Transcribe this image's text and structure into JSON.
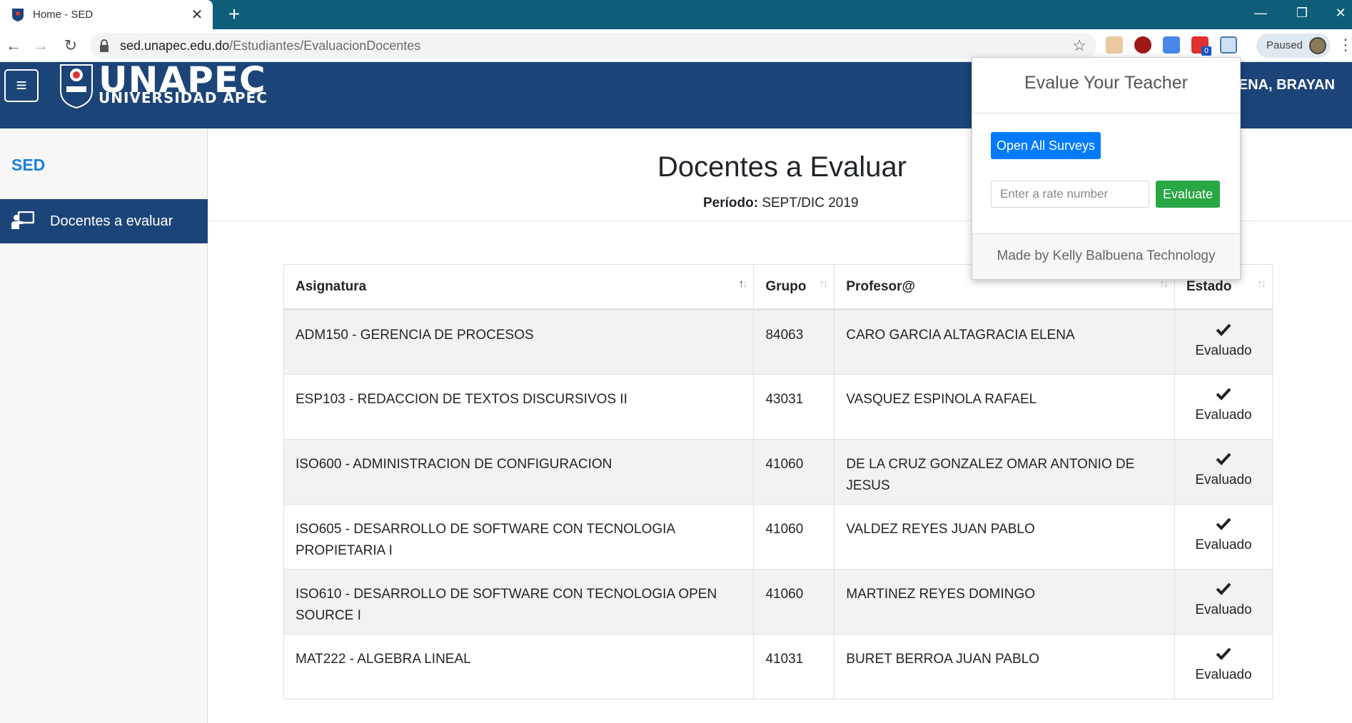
{
  "browser": {
    "tab_title": "Home - SED",
    "url_host": "sed.unapec.edu.do",
    "url_path": "/Estudiantes/EvaluacionDocentes",
    "profile_status": "Paused",
    "extension_badge": "0"
  },
  "header": {
    "logo_main": "UNAPEC",
    "logo_sub": "UNIVERSIDAD APEC",
    "user_name": "ENA, BRAYAN"
  },
  "sidebar": {
    "brand": "SED",
    "items": [
      {
        "label": "Docentes a evaluar",
        "icon": "teacher-board-icon"
      }
    ]
  },
  "main": {
    "title": "Docentes a Evaluar",
    "period_label": "Período:",
    "period_value": " SEPT/DIC 2019",
    "columns": [
      "Asignatura",
      "Grupo",
      "Profesor@",
      "Estado"
    ],
    "rows": [
      {
        "asignatura": "ADM150 - GERENCIA DE PROCESOS",
        "grupo": "84063",
        "profesor": "CARO GARCIA ALTAGRACIA ELENA",
        "estado": "Evaluado"
      },
      {
        "asignatura": "ESP103 - REDACCION DE TEXTOS DISCURSIVOS II",
        "grupo": "43031",
        "profesor": "VASQUEZ ESPINOLA RAFAEL",
        "estado": "Evaluado"
      },
      {
        "asignatura": "ISO600 - ADMINISTRACION DE CONFIGURACION",
        "grupo": "41060",
        "profesor": "DE LA CRUZ GONZALEZ OMAR ANTONIO DE JESUS",
        "estado": "Evaluado"
      },
      {
        "asignatura": "ISO605 - DESARROLLO DE SOFTWARE CON TECNOLOGIA PROPIETARIA I",
        "grupo": "41060",
        "profesor": "VALDEZ REYES JUAN PABLO",
        "estado": "Evaluado"
      },
      {
        "asignatura": "ISO610 - DESARROLLO DE SOFTWARE CON TECNOLOGIA OPEN SOURCE I",
        "grupo": "41060",
        "profesor": "MARTINEZ REYES DOMINGO",
        "estado": "Evaluado"
      },
      {
        "asignatura": "MAT222 - ALGEBRA LINEAL",
        "grupo": "41031",
        "profesor": "BURET BERROA JUAN PABLO",
        "estado": "Evaluado"
      }
    ]
  },
  "popup": {
    "title": "Evalue Your Teacher",
    "open_all_label": "Open All Surveys",
    "rate_placeholder": "Enter a rate number",
    "rate_value": "",
    "evaluate_label": "Evaluate",
    "footer": "Made by Kelly Balbuena Technology"
  },
  "colors": {
    "header_bg": "#1c4478",
    "brand_blue": "#1a7fe0",
    "primary_button": "#007bff",
    "success_button": "#28a745",
    "tabbar": "#0e5e7a"
  }
}
